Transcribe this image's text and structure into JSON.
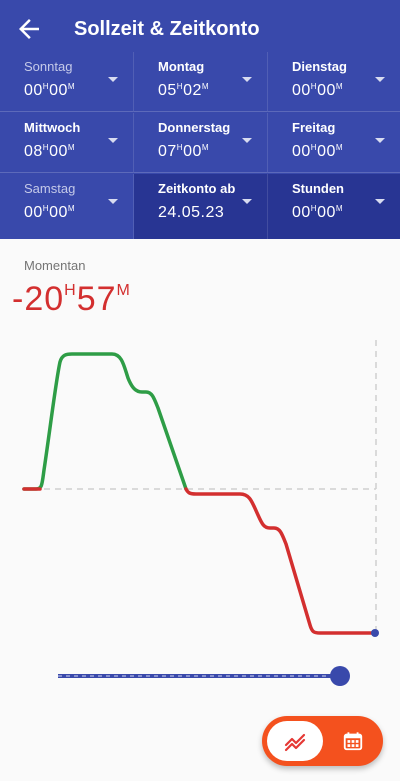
{
  "appbar": {
    "title": "Sollzeit & Zeitkonto"
  },
  "days": [
    {
      "label": "Sonntag",
      "h": "00",
      "m": "00"
    },
    {
      "label": "Montag",
      "h": "05",
      "m": "02"
    },
    {
      "label": "Dienstag",
      "h": "00",
      "m": "00"
    },
    {
      "label": "Mittwoch",
      "h": "08",
      "m": "00"
    },
    {
      "label": "Donnerstag",
      "h": "07",
      "m": "00"
    },
    {
      "label": "Freitag",
      "h": "00",
      "m": "00"
    },
    {
      "label": "Samstag",
      "h": "00",
      "m": "00"
    }
  ],
  "zeitkonto": {
    "label": "Zeitkonto ab",
    "value": "24.05.23"
  },
  "stunden": {
    "label": "Stunden",
    "h": "00",
    "m": "00"
  },
  "units": {
    "hour": "H",
    "minute": "M"
  },
  "momentan": {
    "label": "Momentan",
    "h": "-20",
    "m": "57"
  },
  "colors": {
    "primary": "#3949ab",
    "primary_dark": "#283593",
    "positive": "#2e9d46",
    "negative": "#d32f2f",
    "accent": "#f4511e"
  },
  "slider": {
    "value_fraction": 1.0
  },
  "fab": {
    "left_icon": "trend-icon",
    "right_icon": "calendar-icon"
  }
}
